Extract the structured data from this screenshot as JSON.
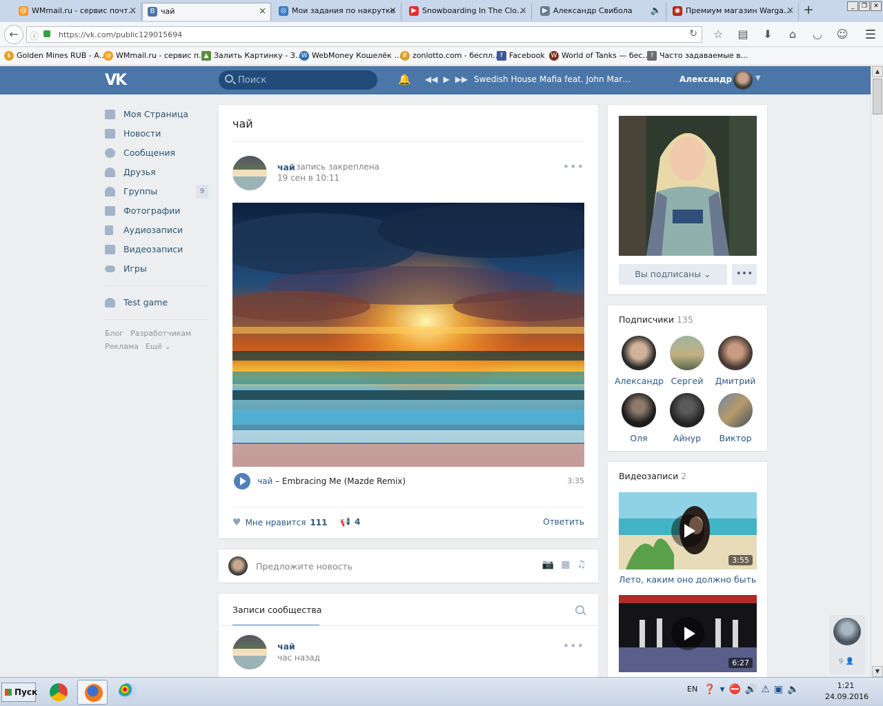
{
  "browser": {
    "tabs": [
      {
        "title": "WMmail.ru - сервис почт…",
        "icon": "wmmail-icon",
        "color": "#f39b1a"
      },
      {
        "title": "чай",
        "icon": "vk-icon",
        "color": "#4a76a8",
        "active": true
      },
      {
        "title": "Мои задания по накрутке",
        "icon": "spiral-icon",
        "color": "#3a78c4"
      },
      {
        "title": "Snowboarding In The Clo…",
        "icon": "youtube-icon",
        "color": "#e52d27"
      },
      {
        "title": "Александр Свибола",
        "icon": "play-icon",
        "color": "#6b7c93"
      },
      {
        "title": "Премиум магазин Warga…",
        "icon": "wargaming-icon",
        "color": "#b0281e"
      }
    ],
    "url": "https://vk.com/public129015694",
    "bookmarks": [
      {
        "label": "Golden Mines RUB - A…",
        "color": "#e3a21a"
      },
      {
        "label": "WMmail.ru - сервис п…",
        "color": "#f39b1a"
      },
      {
        "label": "Залить Картинку - З…",
        "color": "#5a8f3c"
      },
      {
        "label": "WebMoney Кошелёк …",
        "color": "#2f6fb3"
      },
      {
        "label": "zonlotto.com - беспл…",
        "color": "#d9a22a"
      },
      {
        "label": "Facebook",
        "color": "#3b5998"
      },
      {
        "label": "World of Tanks — бес…",
        "color": "#7a2f1c"
      },
      {
        "label": "Часто задаваемые в…",
        "color": "#6d6d6d"
      }
    ]
  },
  "vk": {
    "search_placeholder": "Поиск",
    "now_playing": "Swedish House Mafia feat. John Mar…",
    "user_name": "Александр",
    "nav": [
      {
        "label": "Моя Страница",
        "icon": "home-icon"
      },
      {
        "label": "Новости",
        "icon": "news-icon"
      },
      {
        "label": "Сообщения",
        "icon": "messages-icon"
      },
      {
        "label": "Друзья",
        "icon": "friends-icon"
      },
      {
        "label": "Группы",
        "icon": "groups-icon",
        "badge": "9"
      },
      {
        "label": "Фотографии",
        "icon": "camera-icon"
      },
      {
        "label": "Аудиозаписи",
        "icon": "music-icon"
      },
      {
        "label": "Видеозаписи",
        "icon": "video-icon"
      },
      {
        "label": "Игры",
        "icon": "gamepad-icon"
      }
    ],
    "app_link": "Test game",
    "footer": [
      "Блог",
      "Разработчикам",
      "Реклама",
      "Ещё ⌄"
    ]
  },
  "page": {
    "title": "чай",
    "post": {
      "author": "чай",
      "pinned": "запись закреплена",
      "date": "19 сен в 10:11",
      "audio_artist": "чай",
      "audio_dash": "–",
      "audio_title": "Embracing Me (Mazde Remix)",
      "audio_duration": "3:35",
      "likes_label": "Мне нравится",
      "likes_count": "111",
      "shares_count": "4",
      "reply_label": "Ответить"
    },
    "suggest_placeholder": "Предложите новость",
    "wall_tab": "Записи сообщества",
    "second_post": {
      "author": "чай",
      "date": "час назад"
    }
  },
  "sidebar": {
    "subscribe_label": "Вы подписаны ⌄",
    "more_label": "•••",
    "followers_title": "Подписчики",
    "followers_count": "135",
    "followers": [
      {
        "name": "Александр"
      },
      {
        "name": "Сергей"
      },
      {
        "name": "Дмитрий"
      },
      {
        "name": "Оля"
      },
      {
        "name": "Айнур"
      },
      {
        "name": "Виктор"
      }
    ],
    "videos_title": "Видеозаписи",
    "videos_count": "2",
    "videos": [
      {
        "title": "Лето, каким оно должно быть",
        "duration": "3:55"
      },
      {
        "title": "",
        "duration": "6:27"
      }
    ],
    "chat_count": "9"
  },
  "taskbar": {
    "start_label": "Пуск",
    "lang": "EN",
    "time": "1:21",
    "date": "24.09.2016"
  }
}
